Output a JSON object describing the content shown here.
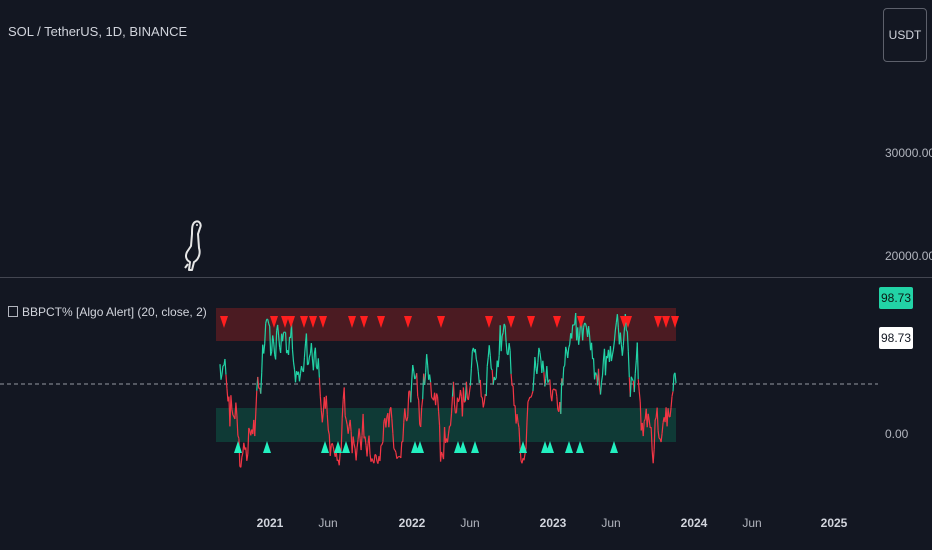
{
  "header": {
    "symbol_title": "SOL / TetherUS, 1D, BINANCE",
    "currency_label": "USDT"
  },
  "price_axis": {
    "labels": [
      "30000.00",
      "20000.00"
    ]
  },
  "indicator": {
    "title": "BBPCT% [Algo Alert] (20, close, 2)",
    "zero_label": "0.00",
    "value_badge_top": "98.73",
    "value_badge_bottom": "98.73"
  },
  "time_axis": {
    "labels": [
      {
        "text": "2021",
        "year": true
      },
      {
        "text": "Jun",
        "year": false
      },
      {
        "text": "2022",
        "year": true
      },
      {
        "text": "Jun",
        "year": false
      },
      {
        "text": "2023",
        "year": true
      },
      {
        "text": "Jun",
        "year": false
      },
      {
        "text": "2024",
        "year": true
      },
      {
        "text": "Jun",
        "year": false
      },
      {
        "text": "2025",
        "year": true
      }
    ]
  },
  "colors": {
    "background": "#131722",
    "overbought_band": "#7a1f23",
    "oversold_band": "#0e4a3e",
    "bull_line": "#22d3a6",
    "bear_line": "#f23645",
    "up_marker": "#22f0c0",
    "down_marker": "#ff1f1f"
  },
  "icons": {
    "marker_icon": "dinosaur-icon"
  }
}
